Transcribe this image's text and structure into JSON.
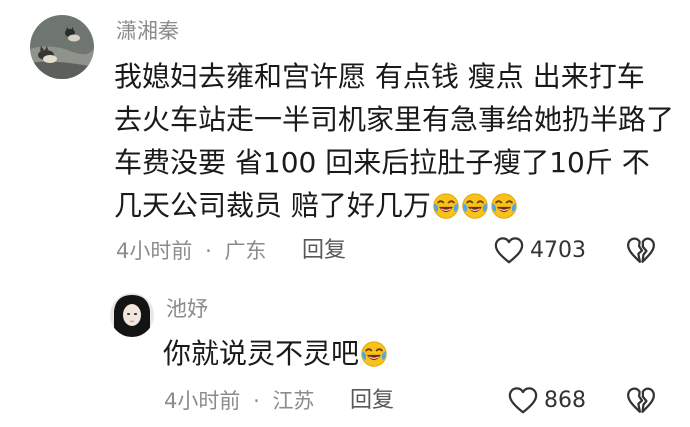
{
  "comments": [
    {
      "username": "潇湘秦",
      "avatar": "cat-on-rock-photo",
      "text_lines": [
        "我媳妇去雍和宫许愿 有点钱  瘦点  出来打车",
        "去火车站走一半司机家里有急事给她扔半路了",
        "车费没要 省100  回来后拉肚子瘦了10斤  不",
        "几天公司裁员  赔了好几万"
      ],
      "emoji": "laughing-crying-emoji",
      "emoji_count": 3,
      "time": "4小时前",
      "separator": "·",
      "location": "广东",
      "reply_label": "回复",
      "likes": "4703",
      "like_icon": "heart-outline-icon",
      "dislike_icon": "broken-heart-icon"
    },
    {
      "username": "池妤",
      "avatar": "woman-portrait-photo",
      "text_lines": [
        "你就说灵不灵吧"
      ],
      "emoji": "laughing-crying-emoji",
      "emoji_count": 1,
      "time": "4小时前",
      "separator": "·",
      "location": "江苏",
      "reply_label": "回复",
      "likes": "868",
      "like_icon": "heart-outline-icon",
      "dislike_icon": "broken-heart-icon"
    }
  ],
  "colors": {
    "meta_text": "#8c8c8c",
    "body_text": "#1a1a1a",
    "emoji_face": "#f7c21a"
  }
}
